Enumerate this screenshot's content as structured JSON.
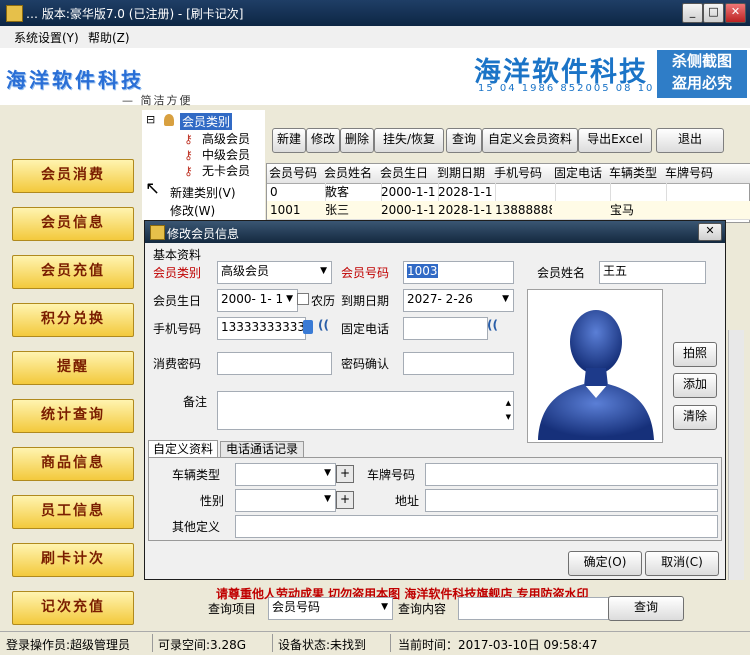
{
  "window": {
    "title": "… 版本:豪华版7.0 (已注册) - [刷卡记次]",
    "minimize": "_",
    "maximize": "□",
    "close": "✕"
  },
  "menu": [
    "系统设置(Y)",
    "帮助(Z)"
  ],
  "banner": {
    "logo_left": "海洋软件科技",
    "slogan": "— 简洁方便",
    "logo_right": "海洋软件科技",
    "logo_numbers": "15 04 1986 852005 08 10",
    "stamp_line1": "杀侧截图",
    "stamp_line2": "盗用必究"
  },
  "nav": [
    "会员消费",
    "会员信息",
    "会员充值",
    "积分兑换",
    "提醒",
    "统计查询",
    "商品信息",
    "员工信息",
    "刷卡计次",
    "记次充值"
  ],
  "tree": {
    "root_toggle": "⊟",
    "root": "会员类别",
    "children": [
      "高级会员",
      "中级会员",
      "无卡会员"
    ],
    "actions": [
      "新建类别(V)",
      "修改(W)"
    ]
  },
  "toolbar": [
    "新建",
    "修改",
    "删除",
    "挂失/恢复",
    "查询",
    "自定义会员资料",
    "导出Excel",
    "退出"
  ],
  "grid": {
    "columns": [
      "会员号码",
      "会员姓名",
      "会员生日",
      "到期日期",
      "手机号码",
      "固定电话",
      "车辆类型",
      "车牌号码"
    ],
    "rows": [
      [
        "0",
        "散客",
        "2000-1-1 P",
        "2028-1-1 P",
        "",
        "",
        "",
        ""
      ],
      [
        "1001",
        "张三",
        "2000-1-1 P",
        "2028-1-1 P",
        "138888888",
        "",
        "宝马",
        ""
      ]
    ]
  },
  "dialog": {
    "title": "修改会员信息",
    "close": "✕",
    "group": "基本资料",
    "member_type_label": "会员类别",
    "member_type_value": "高级会员",
    "member_no_label": "会员号码",
    "member_no_value": "1003",
    "member_name_label": "会员姓名",
    "member_name_value": "王五",
    "birthday_label": "会员生日",
    "birthday_value": "2000- 1- 1",
    "lunar_label": "农历",
    "expire_label": "到期日期",
    "expire_value": "2027- 2-26",
    "mobile_label": "手机号码",
    "mobile_value": "13333333333",
    "phone_label": "固定电话",
    "phone_value": "",
    "pwd_label": "消费密码",
    "pwd_confirm_label": "密码确认",
    "note_label": "备注",
    "photo_btn": "拍照",
    "add_btn": "添加",
    "clear_btn": "清除",
    "tabs": [
      "自定义资料",
      "电话通话记录"
    ],
    "vehicle_type_label": "车辆类型",
    "plate_label": "车牌号码",
    "gender_label": "性别",
    "address_label": "地址",
    "other_label": "其他定义",
    "ok_btn": "确定(O)",
    "cancel_btn": "取消(C)"
  },
  "search": {
    "item_label": "查询项目",
    "item_value": "会员号码",
    "content_label": "查询内容",
    "button": "查询"
  },
  "watermark": "请尊重他人劳动成果   切勿盗用本图   海洋软件科技旗舰店   专用防盗水印",
  "status": {
    "operator": "登录操作员:超级管理员",
    "space": "可录空间:3.28G",
    "device": "设备状态:未找到",
    "time": "当前时间：2017-03-10日 09:58:47"
  },
  "colors": {
    "title_bar": "#1f3e66",
    "nav_button": "#f3c93c",
    "label_red": "#c00000",
    "selection": "#316ac5"
  }
}
